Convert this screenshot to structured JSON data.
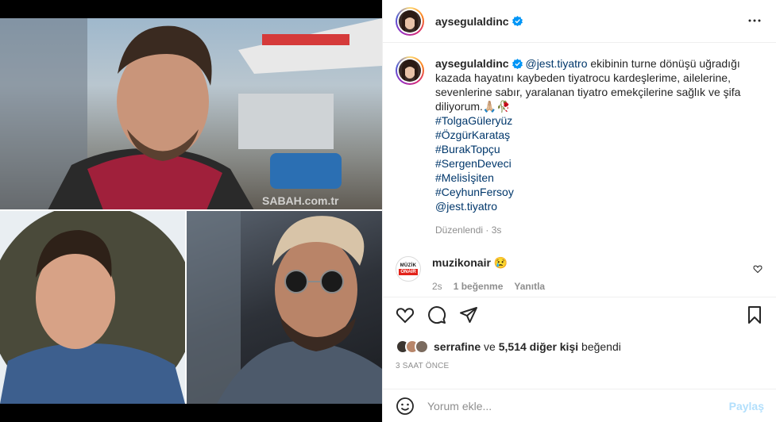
{
  "media": {
    "watermark": "SABAH.com.tr"
  },
  "header": {
    "username": "aysegulaldinc",
    "verified_icon": "verified-badge-icon",
    "more_icon": "more-horizontal-icon"
  },
  "caption": {
    "username": "aysegulaldinc",
    "mention": "@jest.tiyatro",
    "text": " ekibinin turne dönüşü uğradığı kazada hayatını kaybeden tiyatrocu kardeşlerime, ailelerine, sevenlerine sabır, yaralanan tiyatro emekçilerine sağlık ve şifa diliyorum.🙏🏼🥀",
    "tags": [
      "#TolgaGüleryüz",
      "#ÖzgürKarataş",
      "#BurakTopçu",
      "#SergenDeveci",
      "#Melisİşiten",
      "#CeyhunFersoy",
      "@jest.tiyatro"
    ],
    "meta": "Düzenlendi · 3s"
  },
  "comment": {
    "avatar_text1": "MÜZİK",
    "avatar_text2": "ONAIR",
    "username": "muzikonair",
    "text": " 😢",
    "time": "2s",
    "likes": "1 beğenme",
    "reply": "Yanıtla"
  },
  "likes": {
    "user": "serrafine",
    "connector": " ve ",
    "others": "5,514 diğer kişi",
    "suffix": " beğendi"
  },
  "timestamp": "3 SAAT ÖNCE",
  "comment_box": {
    "placeholder": "Yorum ekle...",
    "post_label": "Paylaş"
  },
  "colors": {
    "link": "#00376b",
    "verified": "#0095f6",
    "post_button_disabled": "#b2dffc"
  }
}
